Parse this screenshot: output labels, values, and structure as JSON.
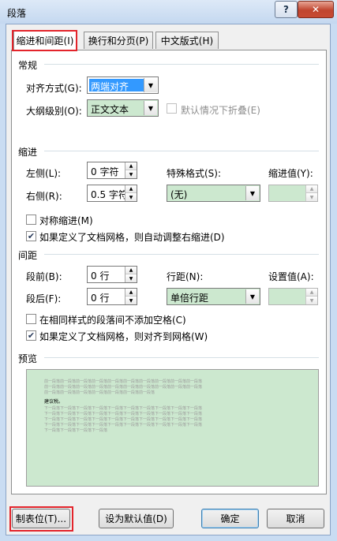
{
  "window": {
    "title": "段落",
    "help": "?",
    "close": "✕"
  },
  "tabs": [
    {
      "label": "缩进和间距(I)"
    },
    {
      "label": "换行和分页(P)"
    },
    {
      "label": "中文版式(H)"
    }
  ],
  "general": {
    "section": "常规",
    "alignment_label": "对齐方式(G):",
    "alignment_value": "两端对齐",
    "outline_label": "大纲级别(O):",
    "outline_value": "正文文本",
    "collapse_label": "默认情况下折叠(E)"
  },
  "indent": {
    "section": "缩进",
    "left_label": "左侧(L):",
    "left_value": "0 字符",
    "right_label": "右侧(R):",
    "right_value": "0.5 字符",
    "special_label": "特殊格式(S):",
    "special_value": "(无)",
    "by_label": "缩进值(Y):",
    "by_value": "",
    "mirror_label": "对称缩进(M)",
    "auto_adjust_label": "如果定义了文档网格，则自动调整右缩进(D)"
  },
  "spacing": {
    "section": "间距",
    "before_label": "段前(B):",
    "before_value": "0 行",
    "after_label": "段后(F):",
    "after_value": "0 行",
    "line_label": "行距(N):",
    "line_value": "单倍行距",
    "at_label": "设置值(A):",
    "at_value": "",
    "no_space_label": "在相同样式的段落间不添加空格(C)",
    "snap_grid_label": "如果定义了文档网格，则对齐到网格(W)"
  },
  "preview": {
    "section": "预览",
    "prev_text": "前一段落前一段落前一段落前一段落前一段落前一段落前一段落前一段落前一段落前一段落",
    "prev_text_short": "前一段落前一段落前一段落前一段落前一段落前一段落前一段落",
    "sample_text": "建议税。",
    "next_text": "下一段落下一段落下一段落下一段落下一段落下一段落下一段落下一段落下一段落下一段落",
    "next_text_short": "下一段落下一段落下一段落下一段落"
  },
  "buttons": {
    "tabs": "制表位(T)...",
    "set_default": "设为默认值(D)",
    "ok": "确定",
    "cancel": "取消"
  },
  "colors": {
    "highlight": "#e3242b",
    "field_green": "#cce8cf",
    "selection": "#3399ff"
  }
}
